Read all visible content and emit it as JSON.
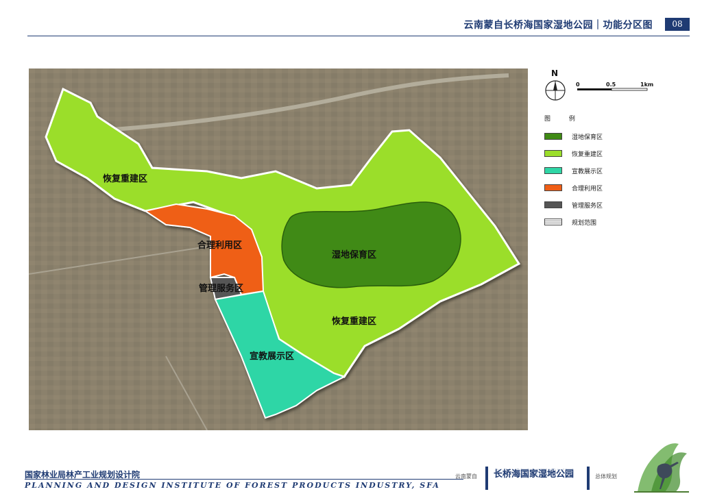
{
  "header": {
    "title": "云南蒙自长桥海国家湿地公园｜功能分区图",
    "page_number": "08"
  },
  "map": {
    "zones": [
      {
        "key": "restore_north",
        "label": "恢复重建区",
        "color": "#9bde2a"
      },
      {
        "key": "reasonable_use",
        "label": "合理利用区",
        "color": "#ef5e16"
      },
      {
        "key": "wetland_protect",
        "label": "湿地保育区",
        "color": "#3f8a14"
      },
      {
        "key": "management",
        "label": "管理服务区",
        "color": "#5a5a5a"
      },
      {
        "key": "restore_south",
        "label": "恢复重建区",
        "color": "#9bde2a"
      },
      {
        "key": "education",
        "label": "宣教展示区",
        "color": "#2fd6a6"
      }
    ]
  },
  "legend": {
    "north_label": "N",
    "scale": {
      "ticks": [
        "0",
        "0.5",
        "1km"
      ]
    },
    "title": "图  例",
    "items": [
      {
        "label": "湿地保育区",
        "color": "#3f8a14"
      },
      {
        "label": "恢复重建区",
        "color": "#9bde2a"
      },
      {
        "label": "宣教展示区",
        "color": "#2fd6a6"
      },
      {
        "label": "合理利用区",
        "color": "#ef5e16"
      },
      {
        "label": "管理服务区",
        "color": "#555555"
      },
      {
        "label": "规划范围",
        "color": "#ffffff"
      }
    ]
  },
  "footer": {
    "institute_cn": "国家林业局林产工业规划设计院",
    "institute_en": "PLANNING AND DESIGN INSTITUTE OF FOREST PRODUCTS INDUSTRY, SFA",
    "left_small": "云南蒙自",
    "park_name": "长桥海国家湿地公园",
    "right_small": "总体规划"
  }
}
